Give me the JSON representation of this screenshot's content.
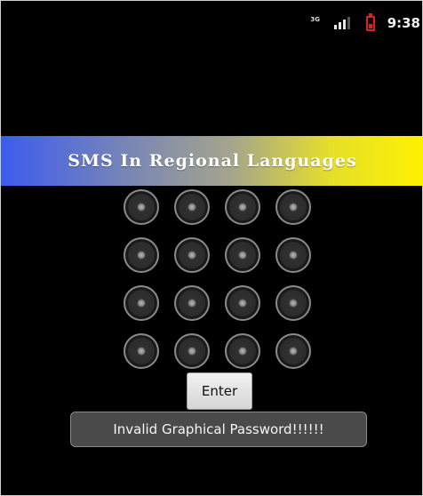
{
  "status_bar": {
    "network_type": "3G",
    "time": "9:38"
  },
  "title": "SMS In Regional Languages",
  "password_grid": {
    "rows": 4,
    "columns": 4,
    "dot_icon": "radio-dot-icon"
  },
  "enter_button": {
    "label": "Enter"
  },
  "toast": {
    "message": "Invalid Graphical Password!!!!!!"
  },
  "colors": {
    "background": "#000000",
    "banner_start": "#3c5cf0",
    "banner_end": "#fff100",
    "battery": "#e02020"
  }
}
